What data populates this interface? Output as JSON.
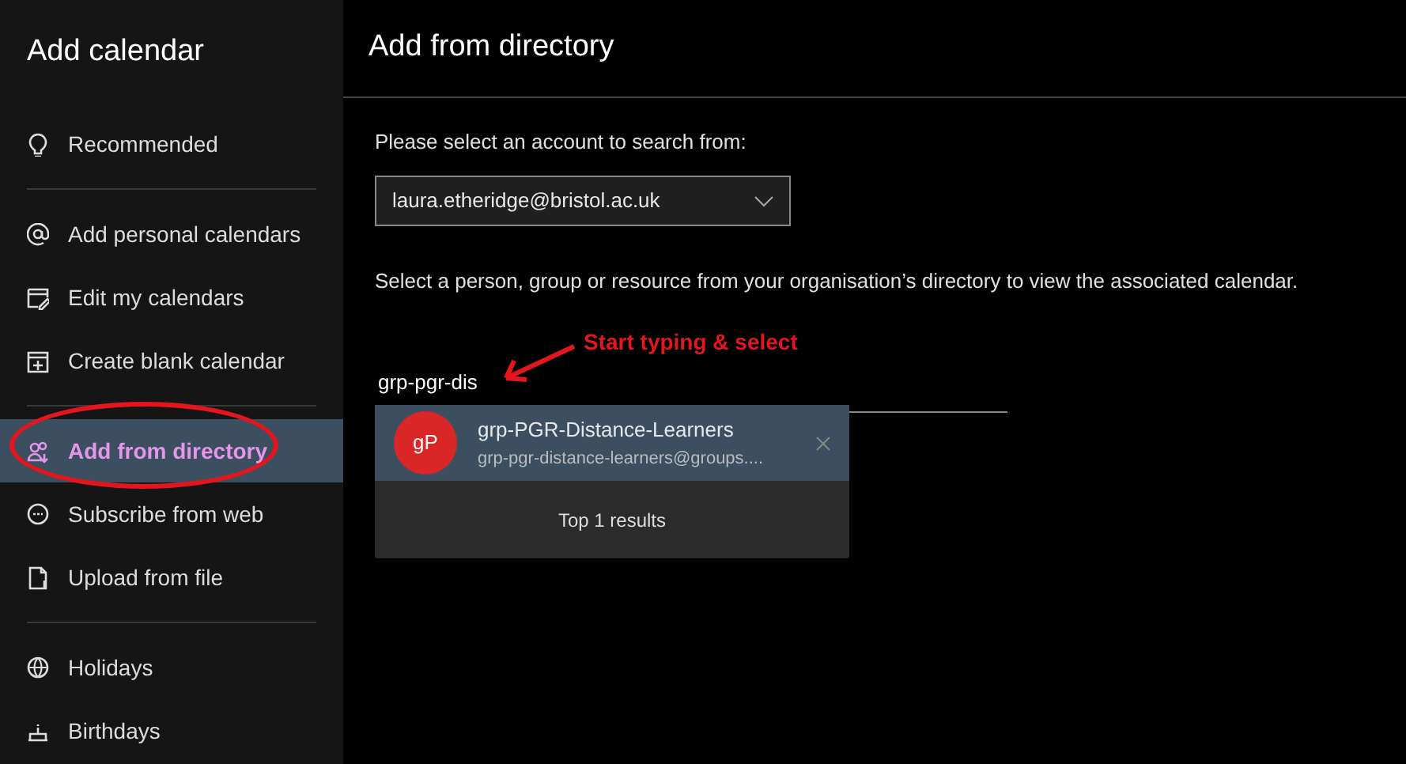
{
  "sidebar": {
    "title": "Add calendar",
    "groups": [
      {
        "items": [
          {
            "label": "Recommended",
            "selected": false
          }
        ]
      },
      {
        "items": [
          {
            "label": "Add personal calendars",
            "selected": false
          },
          {
            "label": "Edit my calendars",
            "selected": false
          },
          {
            "label": "Create blank calendar",
            "selected": false
          }
        ]
      },
      {
        "items": [
          {
            "label": "Add from directory",
            "selected": true
          },
          {
            "label": "Subscribe from web",
            "selected": false
          },
          {
            "label": "Upload from file",
            "selected": false
          }
        ]
      },
      {
        "items": [
          {
            "label": "Holidays",
            "selected": false
          },
          {
            "label": "Birthdays",
            "selected": false
          }
        ]
      }
    ]
  },
  "main": {
    "title": "Add from directory",
    "account_label": "Please select an account to search from:",
    "account_select": {
      "value": "laura.etheridge@bristol.ac.uk"
    },
    "description": "Select a person, group or resource from your organisation’s directory to view the associated calendar.",
    "search_field": {
      "value": "grp-pgr-dis"
    },
    "suggestions": [
      {
        "initials": "gP",
        "color": "#d92626",
        "name": "grp-PGR-Distance-Learners",
        "email": "grp-pgr-distance-learners@groups....",
        "selected": true
      }
    ],
    "results_footer": "Top 1 results"
  },
  "annotation": {
    "text": "Start typing & select"
  }
}
